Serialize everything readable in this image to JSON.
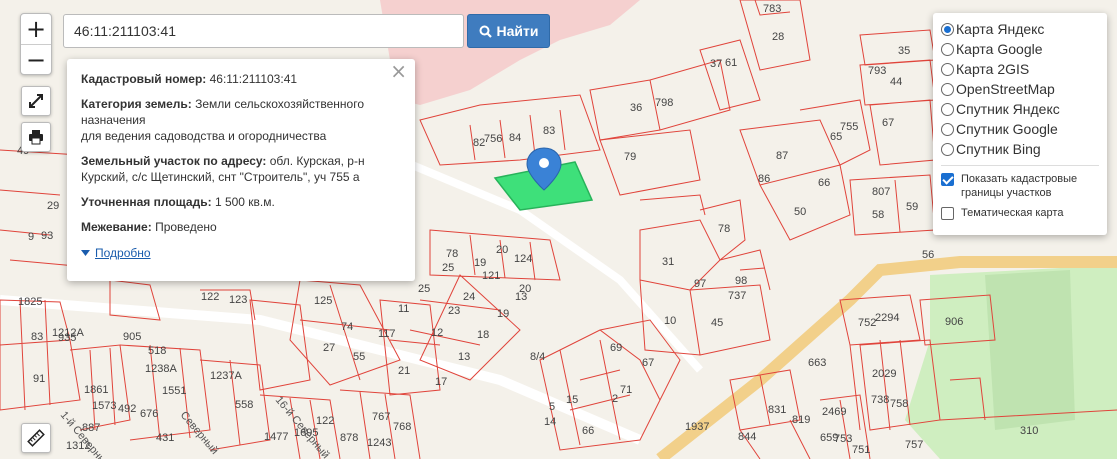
{
  "search": {
    "value": "46:11:211103:41",
    "button_label": "Найти"
  },
  "zoom": {
    "in_label": "+",
    "out_label": "−"
  },
  "info": {
    "cadastral_label": "Кадастровый номер:",
    "cadastral_value": "46:11:211103:41",
    "category_label": "Категория земель:",
    "category_value_1": "Земли сельскохозяйственного назначения",
    "category_value_2": "для ведения садоводства и огородничества",
    "address_label": "Земельный участок по адресу:",
    "address_value": "обл. Курская, р-н Курский, с/с Щетинский, снт \"Строитель\", уч 755 а",
    "area_label": "Уточненная площадь:",
    "area_value": "1 500 кв.м.",
    "survey_label": "Межевание:",
    "survey_value": "Проведено",
    "more_label": "Подробно",
    "close_label": "×"
  },
  "layers": {
    "options": [
      {
        "label": "Карта Яндекс",
        "selected": true
      },
      {
        "label": "Карта Google",
        "selected": false
      },
      {
        "label": "Карта 2GIS",
        "selected": false
      },
      {
        "label": "OpenStreetMap",
        "selected": false
      },
      {
        "label": "Спутник Яндекс",
        "selected": false
      },
      {
        "label": "Спутник Google",
        "selected": false
      },
      {
        "label": "Спутник Bing",
        "selected": false
      }
    ],
    "show_borders_label": "Показать кадастровые границы участков",
    "show_borders_checked": true,
    "thematic_label": "Тематическая карта",
    "thematic_checked": false
  },
  "map": {
    "colors": {
      "background": "#f4f1ea",
      "parcel_line": "#e0443b",
      "selected_parcel": "#3ee07a",
      "road": "#f2d08a",
      "park": "#cfeec0",
      "water": "#f5c8c8",
      "marker": "#3a82d6"
    },
    "parcel_numbers": [
      "783",
      "28",
      "35",
      "793",
      "44",
      "37",
      "61",
      "36",
      "798",
      "755",
      "67",
      "65",
      "87",
      "66",
      "86",
      "50",
      "807",
      "58",
      "59",
      "82",
      "756",
      "84",
      "83",
      "79",
      "78",
      "31",
      "97",
      "98",
      "737",
      "10",
      "45",
      "56",
      "906",
      "2294",
      "752",
      "663",
      "2029",
      "738",
      "758",
      "844",
      "831",
      "819",
      "2469",
      "753",
      "659",
      "751",
      "757",
      "310",
      "1937",
      "69",
      "67",
      "71",
      "15",
      "14",
      "66",
      "5",
      "2",
      "8/4",
      "124",
      "20",
      "121",
      "19",
      "20",
      "13",
      "78",
      "25",
      "24",
      "23",
      "19",
      "18",
      "12",
      "13",
      "17",
      "21",
      "55",
      "117",
      "11",
      "25",
      "27",
      "74",
      "125",
      "122",
      "123",
      "1825",
      "83",
      "1212А",
      "935",
      "905",
      "518",
      "1238А",
      "1861",
      "1573",
      "492",
      "676",
      "1551",
      "431",
      "558",
      "1477",
      "1695",
      "122",
      "878",
      "767",
      "768",
      "1243",
      "9",
      "49",
      "24",
      "29",
      "93",
      "91",
      "1237А",
      "887",
      "1312"
    ],
    "street_labels": [
      "1-й Северный",
      "16-й Северный",
      "Северный"
    ]
  }
}
